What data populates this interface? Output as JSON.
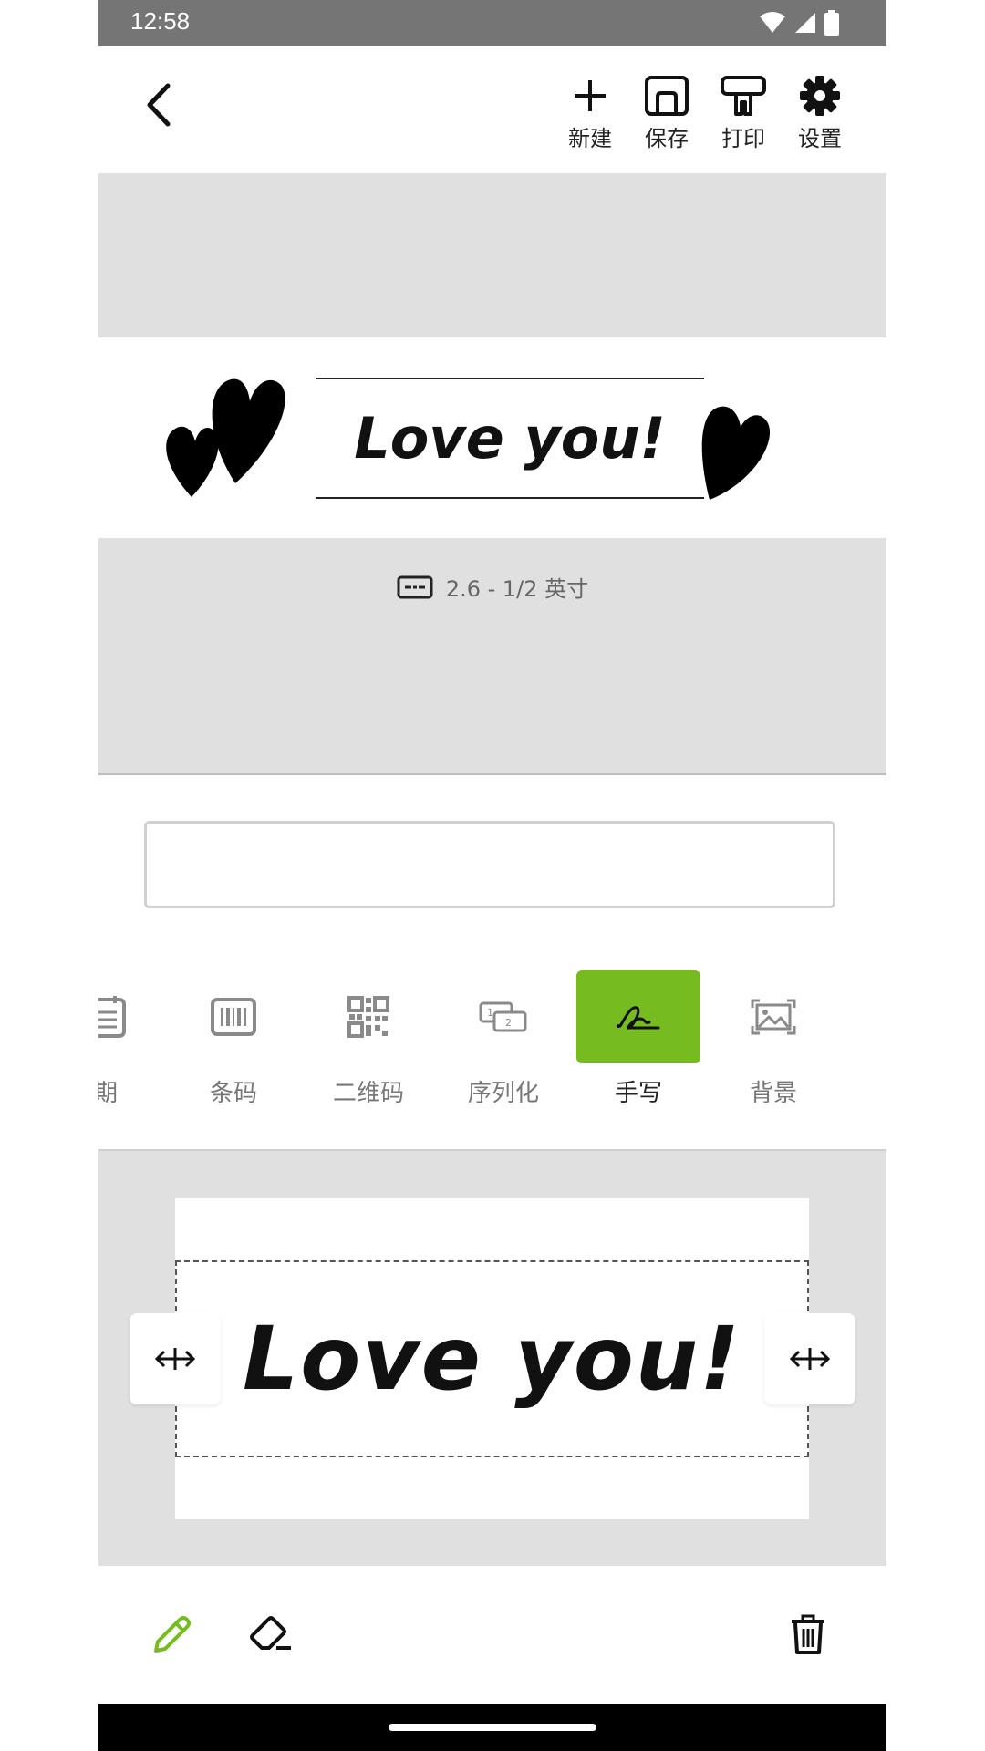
{
  "status_bar": {
    "time": "12:58"
  },
  "toolbar": {
    "new_label": "新建",
    "save_label": "保存",
    "print_label": "打印",
    "settings_label": "设置"
  },
  "label_preview": {
    "text": "Love you!"
  },
  "label_info": {
    "size": "2.6 - 1/2 英寸",
    "icon": "tape-cassette-icon"
  },
  "text_input": {
    "value": ""
  },
  "tools": {
    "items": [
      {
        "label": "期",
        "icon": "calendar-icon"
      },
      {
        "label": "条码",
        "icon": "barcode-icon"
      },
      {
        "label": "二维码",
        "icon": "qr-code-icon"
      },
      {
        "label": "序列化",
        "icon": "serialize-icon"
      },
      {
        "label": "手写",
        "icon": "handwriting-icon",
        "active": true
      },
      {
        "label": "背景",
        "icon": "image-icon"
      }
    ],
    "active_color": "#76bc21"
  },
  "handwriting": {
    "text": "Love you!"
  },
  "bottom_toolbar": {
    "pen_color": "#76bc21"
  }
}
